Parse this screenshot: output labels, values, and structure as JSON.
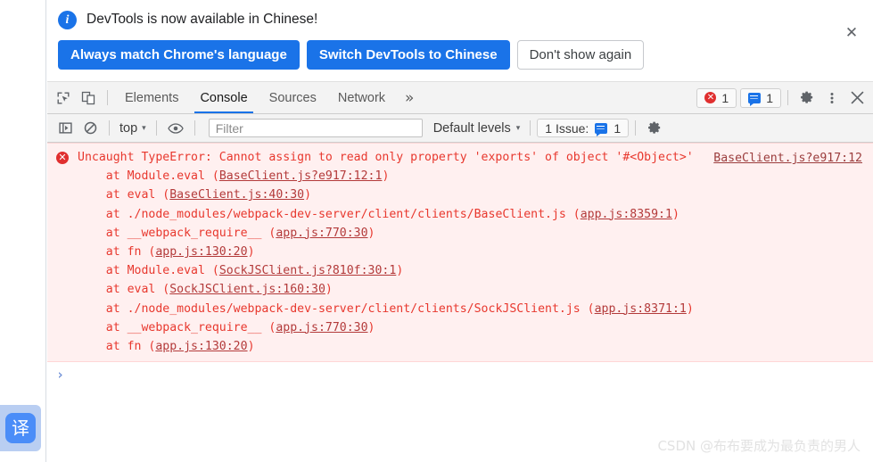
{
  "banner": {
    "info_icon": "info-icon",
    "message": "DevTools is now available in Chinese!",
    "primary_button": "Always match Chrome's language",
    "secondary_button": "Switch DevTools to Chinese",
    "tertiary_button": "Don't show again",
    "close_icon": "✕",
    "primary_color": "#1a73e8"
  },
  "tabbar": {
    "inspect_icon": "inspect-element-icon",
    "device_icon": "device-toolbar-icon",
    "tabs": [
      {
        "label": "Elements",
        "active": false
      },
      {
        "label": "Console",
        "active": true
      },
      {
        "label": "Sources",
        "active": false
      },
      {
        "label": "Network",
        "active": false
      }
    ],
    "more_tabs_icon": "»",
    "error_count": "1",
    "message_count": "1",
    "settings_icon": "gear-icon",
    "more_options_icon": "kebab-menu-icon",
    "close_icon": "✕"
  },
  "console_toolbar": {
    "sidebar_toggle_icon": "console-sidebar-icon",
    "clear_icon": "clear-console-icon",
    "context": "top",
    "caret": "▾",
    "eye_icon": "live-expression-icon",
    "filter_placeholder": "Filter",
    "filter_value": "",
    "levels": "Default levels",
    "issues_label": "1 Issue:",
    "issues_count": "1",
    "settings_icon": "gear-icon"
  },
  "console": {
    "error_icon": "✕",
    "error_message": "Uncaught TypeError: Cannot assign to read only property 'exports' of object '#<Object>'",
    "stack": [
      {
        "prefix": "    at Module.eval (",
        "link": "BaseClient.js?e917:12:1",
        "suffix": ")"
      },
      {
        "prefix": "    at eval (",
        "link": "BaseClient.js:40:30",
        "suffix": ")"
      },
      {
        "prefix": "    at ./node_modules/webpack-dev-server/client/clients/BaseClient.js (",
        "link": "app.js:8359:1",
        "suffix": ")"
      },
      {
        "prefix": "    at __webpack_require__ (",
        "link": "app.js:770:30",
        "suffix": ")"
      },
      {
        "prefix": "    at fn (",
        "link": "app.js:130:20",
        "suffix": ")"
      },
      {
        "prefix": "    at Module.eval (",
        "link": "SockJSClient.js?810f:30:1",
        "suffix": ")"
      },
      {
        "prefix": "    at eval (",
        "link": "SockJSClient.js:160:30",
        "suffix": ")"
      },
      {
        "prefix": "    at ./node_modules/webpack-dev-server/client/clients/SockJSClient.js (",
        "link": "app.js:8371:1",
        "suffix": ")"
      },
      {
        "prefix": "    at __webpack_require__ (",
        "link": "app.js:770:30",
        "suffix": ")"
      },
      {
        "prefix": "    at fn (",
        "link": "app.js:130:20",
        "suffix": ")"
      }
    ],
    "source_link": "BaseClient.js?e917:12",
    "prompt_caret": "›",
    "prompt_value": ""
  },
  "translate_widget": {
    "label": "译"
  },
  "watermark": {
    "text": "CSDN @布布要成为最负责的男人"
  }
}
